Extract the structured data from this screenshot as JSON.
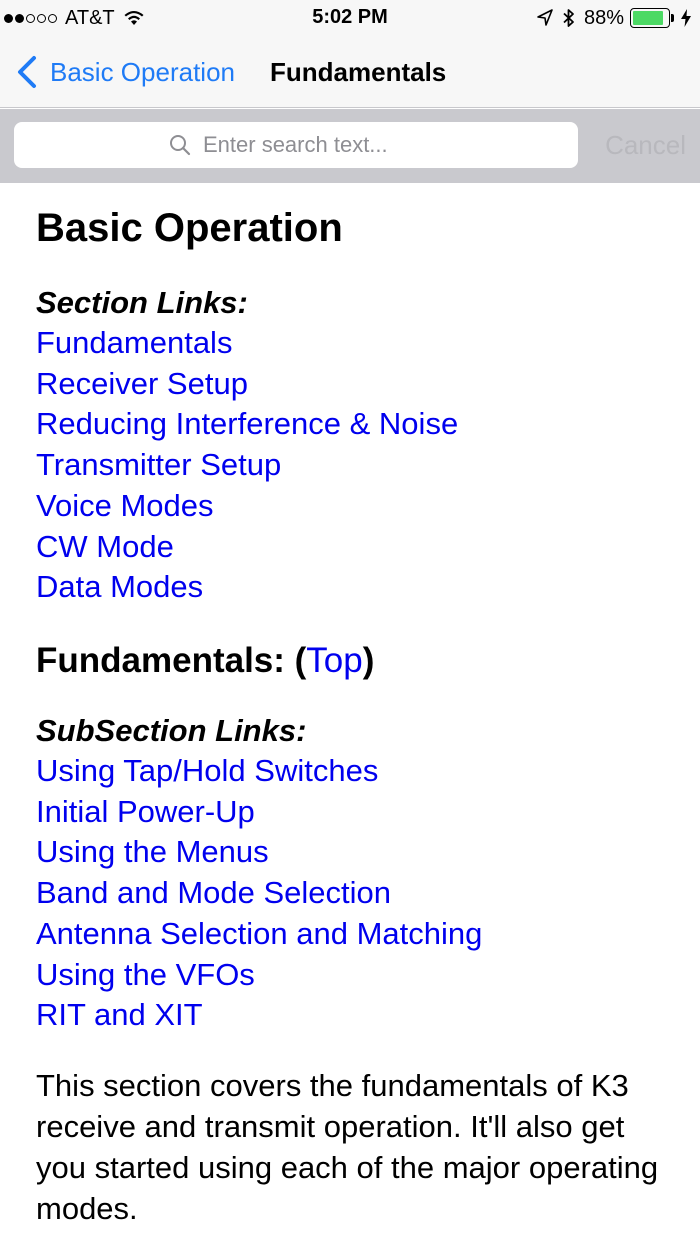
{
  "status_bar": {
    "carrier": "AT&T",
    "time": "5:02 PM",
    "battery_percent": "88%",
    "battery_level": 0.88,
    "signal_bars_filled": 2,
    "signal_bars_total": 5,
    "icons": [
      "wifi-icon",
      "location-icon",
      "bluetooth-icon",
      "battery-icon",
      "charging-bolt-icon"
    ]
  },
  "nav": {
    "back_label": "Basic Operation",
    "title": "Fundamentals"
  },
  "search": {
    "placeholder": "Enter search text...",
    "value": "",
    "cancel_label": "Cancel"
  },
  "content": {
    "heading": "Basic Operation",
    "section_links_label": "Section Links:",
    "section_links": [
      "Fundamentals",
      "Receiver Setup",
      "Reducing Interference & Noise",
      "Transmitter Setup",
      "Voice Modes",
      "CW Mode",
      "Data Modes"
    ],
    "fundamentals_heading": "Fundamentals: (",
    "top_link": "Top",
    "fundamentals_heading_close": ")",
    "subsection_links_label": "SubSection Links:",
    "subsection_links": [
      "Using Tap/Hold Switches",
      "Initial Power-Up",
      "Using the Menus",
      "Band and Mode Selection",
      "Antenna Selection and Matching",
      "Using the VFOs",
      "RIT and XIT"
    ],
    "paragraph": "This section covers the fundamentals of K3 receive and transmit operation. It'll also get you started using each of the major operating modes."
  },
  "colors": {
    "ios_blue": "#1f7bf6",
    "link_blue": "#0000ee",
    "battery_green": "#4cd964",
    "search_bar_bg": "#c9c9ce",
    "cancel_disabled": "#b8b8bd"
  }
}
